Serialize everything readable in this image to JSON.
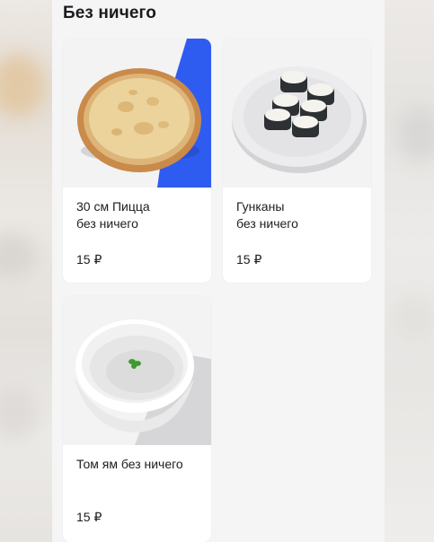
{
  "section": {
    "title": "Без ничего"
  },
  "products": [
    {
      "name": "30 см Пицца\nбез ничего",
      "price": "15 ₽",
      "image": "pizza-image"
    },
    {
      "name": "Гунканы\nбез ничего",
      "price": "15 ₽",
      "image": "sushi-plate-image"
    },
    {
      "name": "Том ям без ничего",
      "price": "15 ₽",
      "image": "soup-bowl-image"
    }
  ],
  "colors": {
    "background": "#f5f5f6",
    "card": "#ffffff",
    "accent_blue": "#2f5cf0",
    "text": "#1d1d22"
  }
}
